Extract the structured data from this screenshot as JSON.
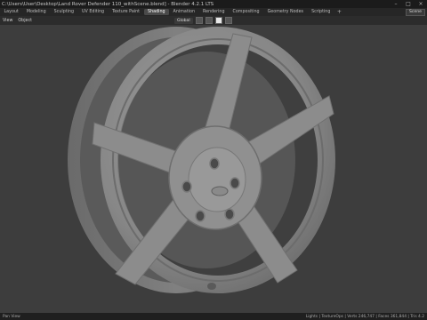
{
  "window": {
    "title": "C:\\Users\\User\\Desktop\\Land Rover Defender 110_withScene.blend] - Blender 4.2.1 LTS"
  },
  "workspaces": [
    "Layout",
    "Modeling",
    "Sculpting",
    "UV Editing",
    "Texture Paint",
    "Shading",
    "Animation",
    "Rendering",
    "Compositing",
    "Geometry Nodes",
    "Scripting"
  ],
  "active_workspace_index": 5,
  "scene_label": "Scene",
  "header": {
    "menu_items": [
      "View",
      "Object"
    ],
    "transform_orientation": "Global"
  },
  "status": {
    "left": "Pan View",
    "right": "Lights | TextureOps | Verts 246,747 | Faces 361,844 | Tris 4.2"
  },
  "colors": {
    "viewport_bg": "#3d3d3d",
    "wheel": "#8a8a8a",
    "accent": "#4a4a4a"
  }
}
